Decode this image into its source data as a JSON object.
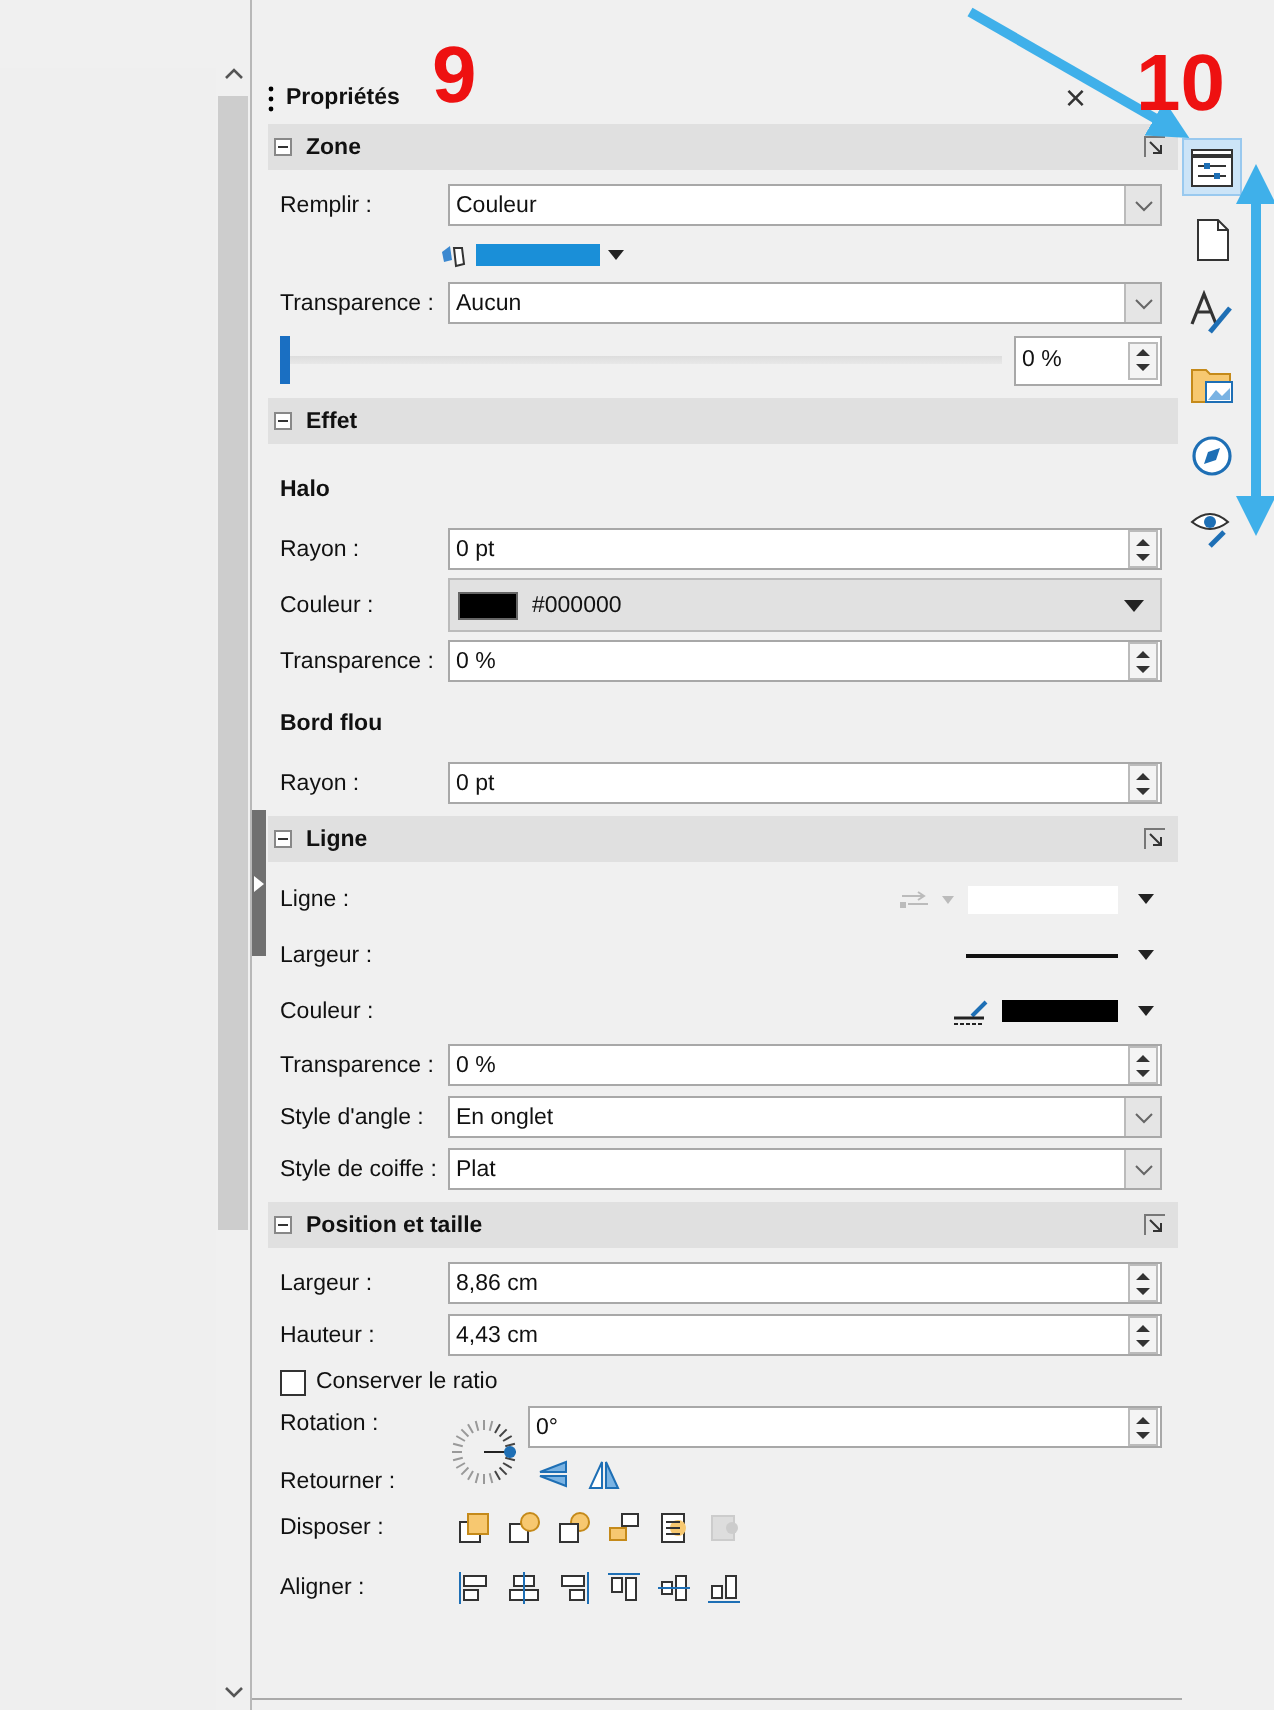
{
  "annotations": [
    {
      "text": "9"
    },
    {
      "text": "10"
    }
  ],
  "panel": {
    "title": "Propriétés",
    "close": "×"
  },
  "sections": [
    {
      "title": "Zone",
      "expanded": true,
      "more_button": true,
      "rows": [
        {
          "kind": "select",
          "label": "Remplir :",
          "value": "Couleur"
        },
        {
          "kind": "fill-color",
          "color": "#1a8fd8"
        },
        {
          "kind": "select",
          "label": "Transparence :",
          "value": "Aucun"
        },
        {
          "kind": "slider",
          "level": 0,
          "value": "0 %"
        }
      ]
    },
    {
      "title": "Effet",
      "expanded": true,
      "more_button": false,
      "rows": [
        {
          "kind": "subheading",
          "text": "Halo"
        },
        {
          "kind": "spin",
          "label": "Rayon :",
          "value": "0 pt"
        },
        {
          "kind": "color-select",
          "label": "Couleur :",
          "value": "#000000",
          "color": "#000000"
        },
        {
          "kind": "spin",
          "label": "Transparence :",
          "value": "0 %"
        },
        {
          "kind": "subheading",
          "text": "Bord flou"
        },
        {
          "kind": "spin",
          "label": "Rayon :",
          "value": "0 pt"
        }
      ]
    },
    {
      "title": "Ligne",
      "expanded": true,
      "more_button": true,
      "rows": [
        {
          "kind": "line-arrows",
          "label": "Ligne :"
        },
        {
          "kind": "line-width",
          "label": "Largeur :"
        },
        {
          "kind": "line-color",
          "label": "Couleur :",
          "color": "#000000"
        },
        {
          "kind": "spin",
          "label": "Transparence :",
          "value": "0 %"
        },
        {
          "kind": "select",
          "label": "Style d'angle :",
          "value": "En onglet"
        },
        {
          "kind": "select",
          "label": "Style de coiffe :",
          "value": "Plat"
        }
      ]
    },
    {
      "title": "Position et taille",
      "expanded": true,
      "more_button": true,
      "rows": [
        {
          "kind": "spin",
          "label": "Largeur :",
          "value": "8,86 cm"
        },
        {
          "kind": "spin",
          "label": "Hauteur :",
          "value": "4,43 cm"
        },
        {
          "kind": "checkbox",
          "label": "Conserver le ratio",
          "checked": false
        },
        {
          "kind": "rotation",
          "label": "Rotation :",
          "value": "0°",
          "flip_label": "Retourner :"
        },
        {
          "kind": "arrange",
          "label": "Disposer :"
        },
        {
          "kind": "align",
          "label": "Aligner :"
        }
      ]
    }
  ],
  "sidebar_tabs": [
    {
      "kind": "properties",
      "selected": true
    },
    {
      "kind": "page",
      "selected": false
    },
    {
      "kind": "styles",
      "selected": false
    },
    {
      "kind": "gallery",
      "selected": false
    },
    {
      "kind": "navigator",
      "selected": false
    },
    {
      "kind": "inspector",
      "selected": false
    }
  ]
}
